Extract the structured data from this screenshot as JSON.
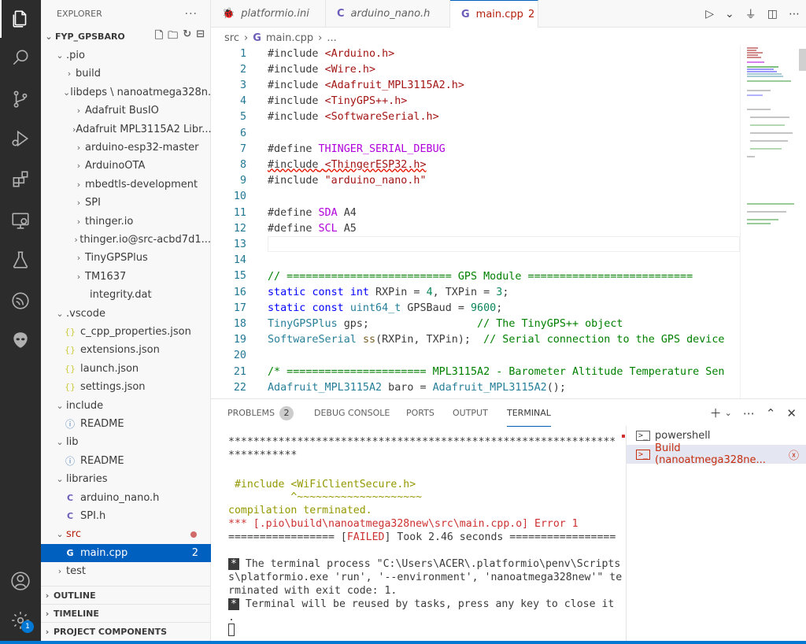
{
  "activity_bar": {
    "icons": [
      "files-icon",
      "search-icon",
      "source-control-icon",
      "run-debug-icon",
      "extensions-icon",
      "remote-explorer-icon",
      "testing-icon",
      "platformio-icon",
      "alien-icon",
      "account-icon",
      "settings-gear-icon"
    ],
    "settings_badge": "1"
  },
  "explorer": {
    "title": "EXPLORER",
    "more": "···",
    "root": "FYP_GPSBARO",
    "tree": [
      {
        "label": ".pio",
        "type": "folder-open",
        "indent": 1
      },
      {
        "label": "build",
        "type": "folder",
        "indent": 2
      },
      {
        "label": "libdeps \\ nanoatmega328n...",
        "type": "folder-open",
        "indent": 2
      },
      {
        "label": "Adafruit BusIO",
        "type": "folder",
        "indent": 3
      },
      {
        "label": "Adafruit MPL3115A2 Libr...",
        "type": "folder",
        "indent": 3
      },
      {
        "label": "arduino-esp32-master",
        "type": "folder",
        "indent": 3
      },
      {
        "label": "ArduinoOTA",
        "type": "folder",
        "indent": 3
      },
      {
        "label": "mbedtls-development",
        "type": "folder",
        "indent": 3
      },
      {
        "label": "SPI",
        "type": "folder",
        "indent": 3
      },
      {
        "label": "thinger.io",
        "type": "folder",
        "indent": 3
      },
      {
        "label": "thinger.io@src-acbd7d1...",
        "type": "folder",
        "indent": 3
      },
      {
        "label": "TinyGPSPlus",
        "type": "folder",
        "indent": 3
      },
      {
        "label": "TM1637",
        "type": "folder",
        "indent": 3
      },
      {
        "label": "integrity.dat",
        "type": "file",
        "indent": 3
      },
      {
        "label": ".vscode",
        "type": "folder-open",
        "indent": 1
      },
      {
        "label": "c_cpp_properties.json",
        "type": "json",
        "indent": 2
      },
      {
        "label": "extensions.json",
        "type": "json",
        "indent": 2
      },
      {
        "label": "launch.json",
        "type": "json",
        "indent": 2
      },
      {
        "label": "settings.json",
        "type": "json",
        "indent": 2
      },
      {
        "label": "include",
        "type": "folder-open",
        "indent": 1
      },
      {
        "label": "README",
        "type": "info",
        "indent": 2
      },
      {
        "label": "lib",
        "type": "folder-open",
        "indent": 1
      },
      {
        "label": "README",
        "type": "info",
        "indent": 2
      },
      {
        "label": "libraries",
        "type": "folder-open",
        "indent": 1
      },
      {
        "label": "arduino_nano.h",
        "type": "c",
        "indent": 2
      },
      {
        "label": "SPI.h",
        "type": "c",
        "indent": 2
      },
      {
        "label": "src",
        "type": "folder-open-error",
        "indent": 1
      },
      {
        "label": "main.cpp",
        "type": "cpp-selected",
        "indent": 2,
        "count": "2"
      },
      {
        "label": "test",
        "type": "folder",
        "indent": 1
      }
    ],
    "sections": [
      "OUTLINE",
      "TIMELINE",
      "PROJECT COMPONENTS"
    ]
  },
  "tabs": [
    {
      "label": "platformio.ini",
      "icon": "platformio-icon"
    },
    {
      "label": "arduino_nano.h",
      "icon": "c-icon"
    },
    {
      "label": "main.cpp",
      "icon": "cpp-icon",
      "count": "2"
    }
  ],
  "breadcrumb": {
    "part1": "src",
    "part2": "main.cpp",
    "part3": "..."
  },
  "editor": {
    "line_numbers": [
      "1",
      "2",
      "3",
      "4",
      "5",
      "6",
      "7",
      "8",
      "9",
      "10",
      "11",
      "12",
      "13",
      "14",
      "15",
      "16",
      "17",
      "18",
      "19",
      "20",
      "21",
      "22"
    ]
  },
  "panel": {
    "tabs": [
      {
        "label": "PROBLEMS",
        "badge": "2"
      },
      {
        "label": "DEBUG CONSOLE"
      },
      {
        "label": "PORTS"
      },
      {
        "label": "OUTPUT"
      },
      {
        "label": "TERMINAL"
      }
    ],
    "terminal_lines": {
      "stars1": "**************************************************************",
      "stars2": "***********",
      "include": " #include <WiFiClientSecure.h>",
      "caret": "          ^~~~~~~~~~~~~~~~~~~~~",
      "terminated": "compilation terminated.",
      "error": "*** [.pio\\build\\nanoatmega328new\\src\\main.cpp.o] Error 1",
      "failed_pre": "================= [",
      "failed_word": "FAILED",
      "failed_post": "] Took 2.46 seconds =================",
      "proc1": " The terminal process \"C:\\Users\\ACER\\.platformio\\penv\\Scripts",
      "proc2": "s\\platformio.exe 'run', '--environment', 'nanoatmega328new'\" te",
      "proc3": "rminated with exit code: 1.",
      "reuse": " Terminal will be reused by tasks, press any key to close it",
      "dot": "."
    },
    "terminals": [
      "powershell",
      "Build (nanoatmega328ne..."
    ]
  }
}
